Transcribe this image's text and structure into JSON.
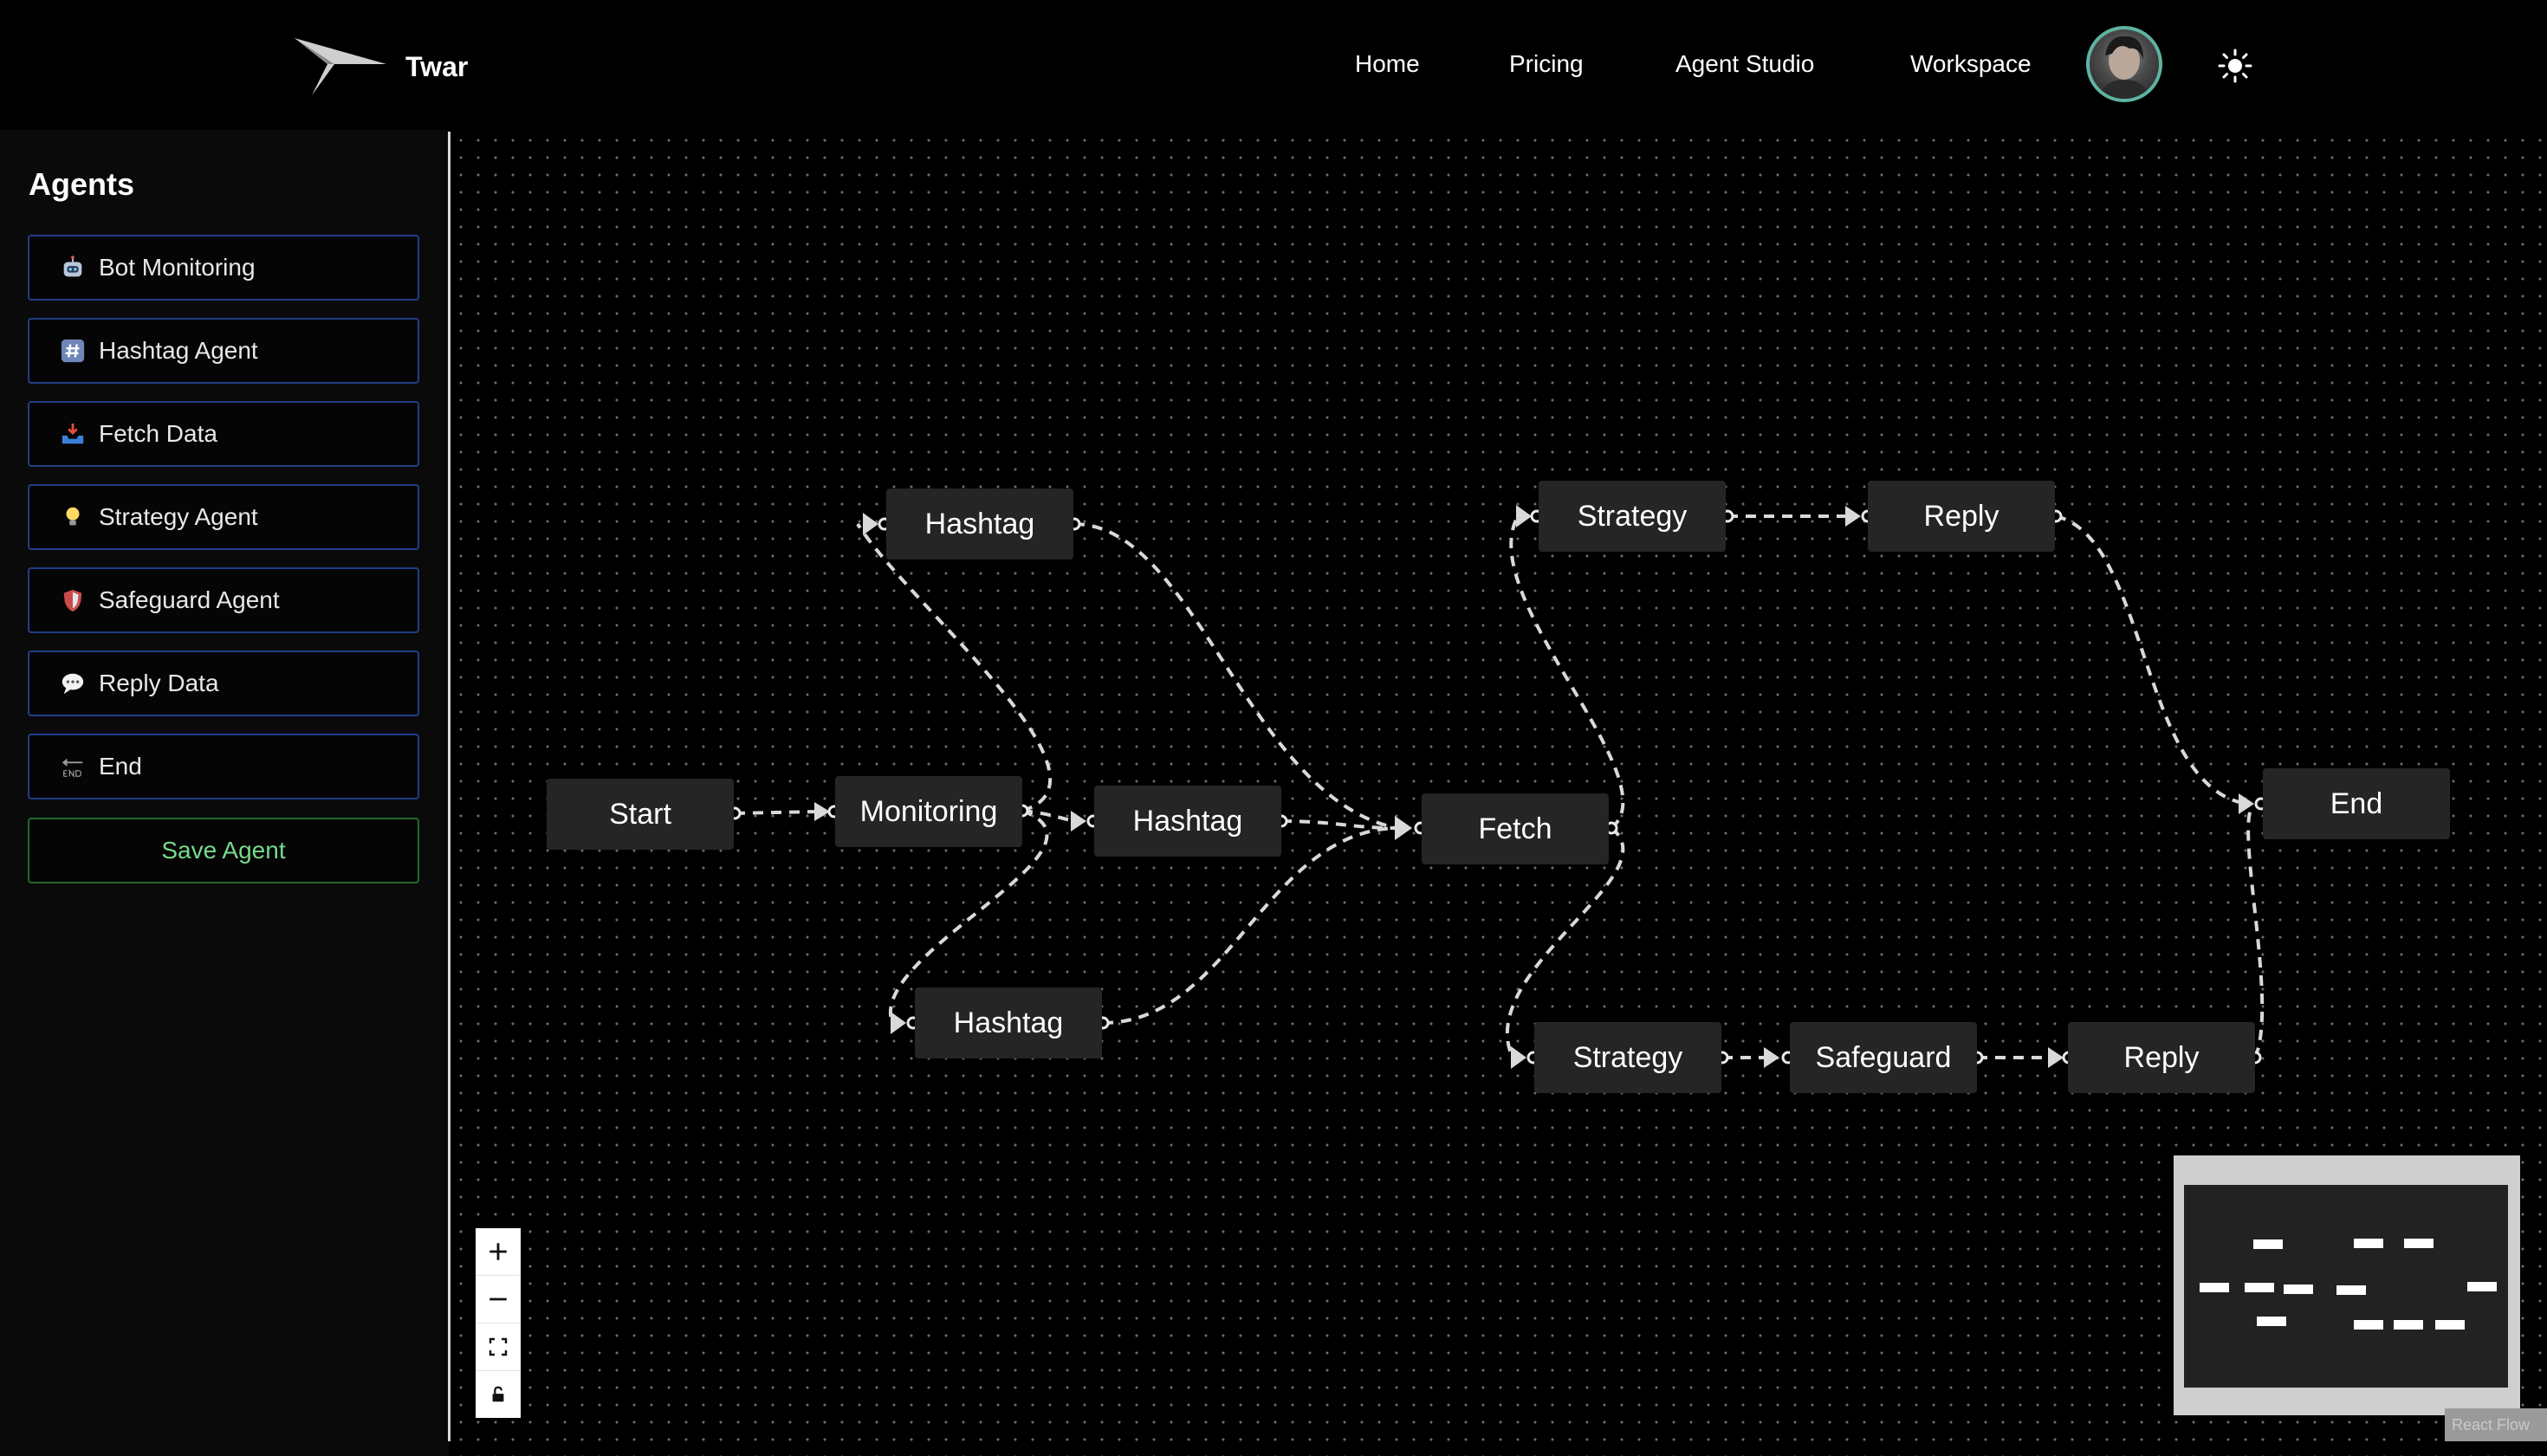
{
  "header": {
    "brand": "Twar",
    "nav": [
      "Home",
      "Pricing",
      "Agent Studio",
      "Workspace"
    ]
  },
  "sidebar": {
    "title": "Agents",
    "items": [
      {
        "label": "Bot Monitoring",
        "icon": "robot-icon"
      },
      {
        "label": "Hashtag Agent",
        "icon": "hashtag-icon"
      },
      {
        "label": "Fetch Data",
        "icon": "inbox-tray-icon"
      },
      {
        "label": "Strategy Agent",
        "icon": "lightbulb-icon"
      },
      {
        "label": "Safeguard Agent",
        "icon": "shield-icon"
      },
      {
        "label": "Reply Data",
        "icon": "speech-bubble-icon"
      },
      {
        "label": "End",
        "icon": "end-arrow-icon"
      }
    ],
    "save_label": "Save Agent"
  },
  "flow": {
    "nodes": [
      {
        "id": "start",
        "label": "Start"
      },
      {
        "id": "monitoring",
        "label": "Monitoring"
      },
      {
        "id": "hashtag-top",
        "label": "Hashtag"
      },
      {
        "id": "hashtag-mid",
        "label": "Hashtag"
      },
      {
        "id": "hashtag-bottom",
        "label": "Hashtag"
      },
      {
        "id": "fetch",
        "label": "Fetch"
      },
      {
        "id": "strategy-top",
        "label": "Strategy"
      },
      {
        "id": "reply-top",
        "label": "Reply"
      },
      {
        "id": "end",
        "label": "End"
      },
      {
        "id": "strategy-bottom",
        "label": "Strategy"
      },
      {
        "id": "safeguard",
        "label": "Safeguard"
      },
      {
        "id": "reply-bottom",
        "label": "Reply"
      }
    ],
    "edges": [
      [
        "start",
        "monitoring"
      ],
      [
        "monitoring",
        "hashtag-top"
      ],
      [
        "monitoring",
        "hashtag-mid"
      ],
      [
        "monitoring",
        "hashtag-bottom"
      ],
      [
        "hashtag-top",
        "fetch"
      ],
      [
        "hashtag-mid",
        "fetch"
      ],
      [
        "hashtag-bottom",
        "fetch"
      ],
      [
        "fetch",
        "strategy-top"
      ],
      [
        "fetch",
        "strategy-bottom"
      ],
      [
        "strategy-top",
        "reply-top"
      ],
      [
        "reply-top",
        "end"
      ],
      [
        "strategy-bottom",
        "safeguard"
      ],
      [
        "safeguard",
        "reply-bottom"
      ],
      [
        "reply-bottom",
        "end"
      ]
    ]
  },
  "controls": [
    "zoom-in-icon",
    "zoom-out-icon",
    "fit-view-icon",
    "lock-icon"
  ],
  "attribution": "React Flow",
  "colors": {
    "background": "#000000",
    "node": "#252525",
    "edge": "#d9d9d9",
    "agent_border": "#1f3f86",
    "save_border": "#1f6a2c",
    "save_text": "#78d98c",
    "avatar_ring": "#5fb3a3"
  }
}
